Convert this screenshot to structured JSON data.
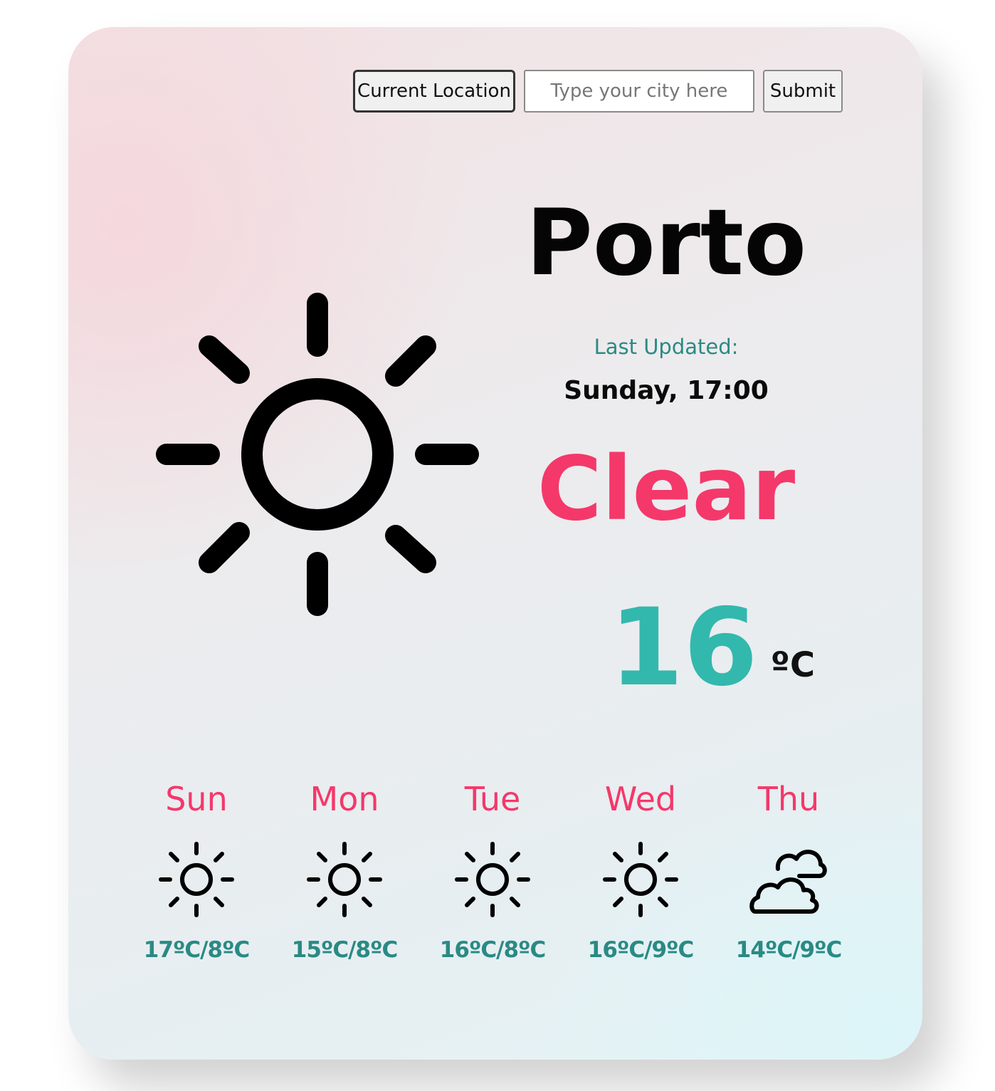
{
  "search": {
    "current_location_label": "Current Location",
    "city_placeholder": "Type your city here",
    "city_value": "",
    "submit_label": "Submit"
  },
  "current": {
    "icon": "sun-icon",
    "city": "Porto",
    "last_updated_label": "Last Updated:",
    "last_updated_time": "Sunday, 17:00",
    "condition": "Clear",
    "temperature": "16",
    "unit": "ºC"
  },
  "forecast": [
    {
      "day": "Sun",
      "icon": "sun-icon",
      "range": "17ºC/8ºC"
    },
    {
      "day": "Mon",
      "icon": "sun-icon",
      "range": "15ºC/8ºC"
    },
    {
      "day": "Tue",
      "icon": "sun-icon",
      "range": "16ºC/8ºC"
    },
    {
      "day": "Wed",
      "icon": "sun-icon",
      "range": "16ºC/9ºC"
    },
    {
      "day": "Thu",
      "icon": "clouds-icon",
      "range": "14ºC/9ºC"
    }
  ],
  "colors": {
    "accent_pink": "#f4386a",
    "accent_teal": "#33b8ad",
    "text_teal": "#2a8a84"
  }
}
